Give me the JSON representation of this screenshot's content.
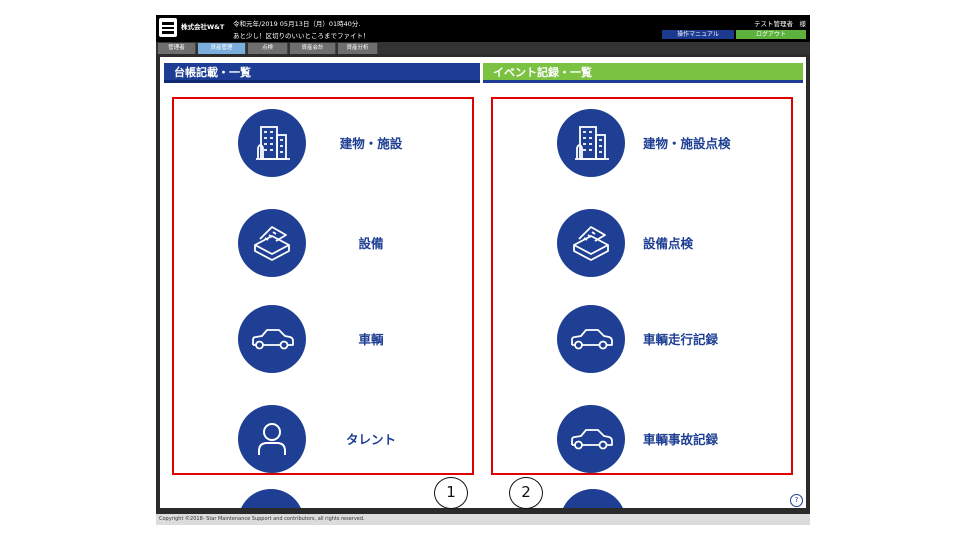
{
  "header": {
    "company": "株式会社W&T",
    "datetime": "令和元年/2019 05月13日（月）01時40分.",
    "message": "あと少し！区切りのいいところまでファイト！",
    "user": "テスト管理者　様",
    "manual_label": "操作マニュアル",
    "logout_label": "ログアウト"
  },
  "tabs": [
    "管理者",
    "資産管理",
    "点検",
    "資産会計",
    "資産分析"
  ],
  "active_tab": "資産管理",
  "left_pane": {
    "title": "台帳記載・一覧",
    "items": [
      {
        "label": "建物・施設",
        "icon": "building-icon"
      },
      {
        "label": "設備",
        "icon": "equipment-icon"
      },
      {
        "label": "車輌",
        "icon": "car-icon"
      },
      {
        "label": "タレント",
        "icon": "person-icon"
      }
    ]
  },
  "right_pane": {
    "title": "イベント記録・一覧",
    "items": [
      {
        "label": "建物・施設点検",
        "icon": "building-icon"
      },
      {
        "label": "設備点検",
        "icon": "equipment-icon"
      },
      {
        "label": "車輌走行記録",
        "icon": "car-icon"
      },
      {
        "label": "車輌事故記録",
        "icon": "car-icon"
      }
    ]
  },
  "markers": [
    "1",
    "2"
  ],
  "help_label": "?",
  "footer": "Copyright ©2018- Star Maintenance Support and contributors, all rights reserved.",
  "colors": {
    "primary_blue": "#1e3f93",
    "accent_green": "#7bc142",
    "highlight_red": "#e00000"
  }
}
